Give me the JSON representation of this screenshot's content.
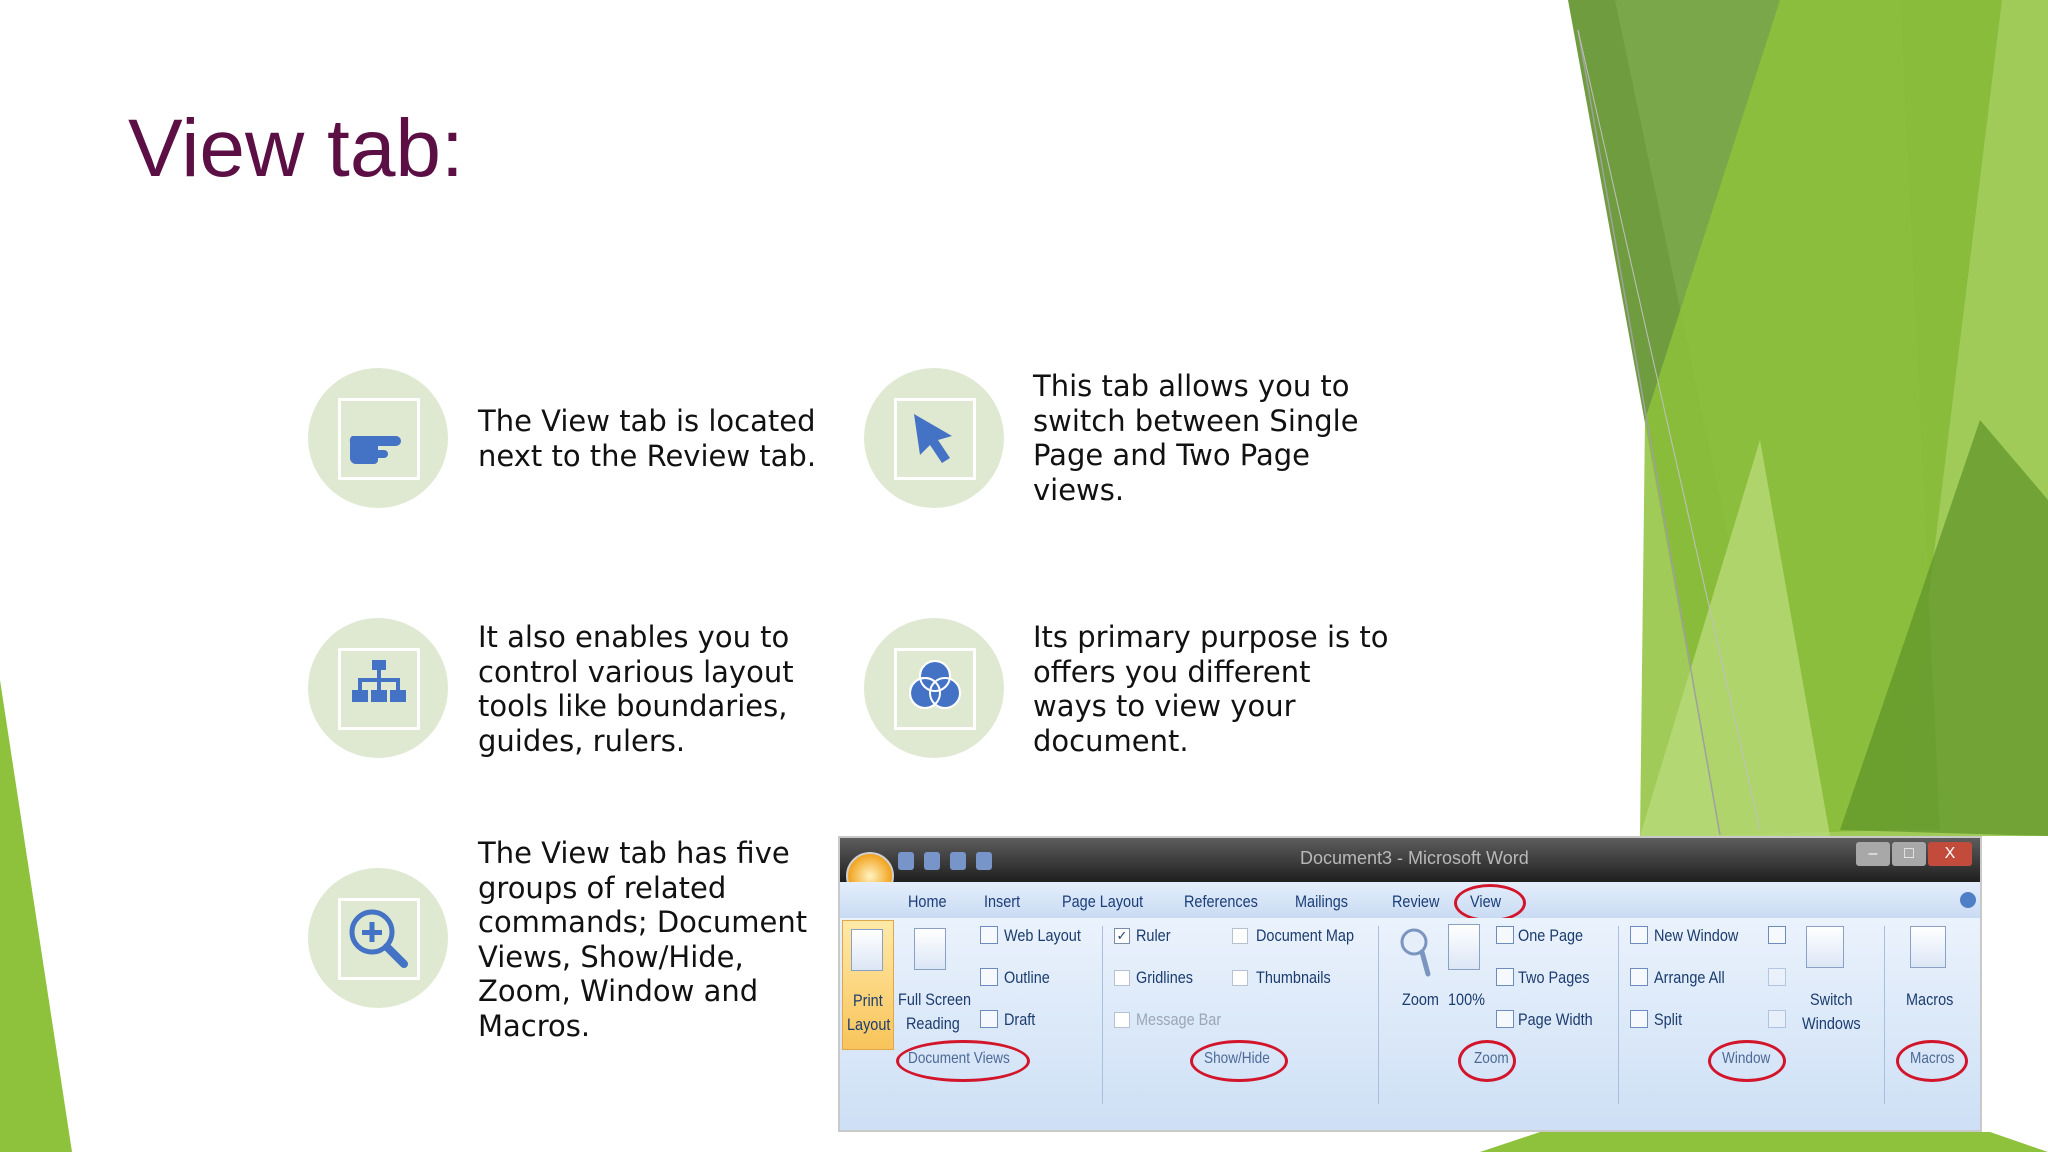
{
  "slide": {
    "title": "View tab:",
    "colors": {
      "title": "#5b0f45",
      "icon_circle": "#dfe9d2",
      "icon": "#4472c4",
      "green_dark": "#6c9a3e",
      "green_light": "#8fc23c"
    },
    "items": [
      {
        "icon": "pointing-hand-icon",
        "text_lines": [
          "The View tab is located",
          "next to the Review tab."
        ]
      },
      {
        "icon": "cursor-arrow-icon",
        "text_lines": [
          "This tab allows you to",
          "switch between Single",
          "Page and Two Page",
          "views."
        ]
      },
      {
        "icon": "org-chart-icon",
        "text_lines": [
          "It also enables you to",
          "control various layout",
          "tools like boundaries,",
          "guides, rulers."
        ]
      },
      {
        "icon": "venn-diagram-icon",
        "text_lines": [
          "Its primary purpose is to",
          "offers you different",
          "ways to view your",
          "document."
        ]
      },
      {
        "icon": "zoom-in-icon",
        "text_lines": [
          "The View tab has five",
          "groups of related",
          "commands; Document",
          "Views, Show/Hide,",
          "Zoom, Window and",
          "Macros."
        ]
      }
    ]
  },
  "screenshot": {
    "window_title": "Document3 - Microsoft Word",
    "window_buttons": [
      "–",
      "□",
      "X"
    ],
    "tabs": [
      "Home",
      "Insert",
      "Page Layout",
      "References",
      "Mailings",
      "Review",
      "View"
    ],
    "document_views": {
      "print_layout": [
        "Print",
        "Layout"
      ],
      "full_screen": [
        "Full Screen",
        "Reading"
      ],
      "web_layout": "Web Layout",
      "outline": "Outline",
      "draft": "Draft"
    },
    "show_hide": {
      "ruler": "Ruler",
      "gridlines": "Gridlines",
      "message_bar": "Message Bar",
      "document_map": "Document Map",
      "thumbnails": "Thumbnails"
    },
    "zoom": {
      "zoom": "Zoom",
      "hundred": "100%",
      "one_page": "One Page",
      "two_pages": "Two Pages",
      "page_width": "Page Width"
    },
    "window": {
      "new_window": "New Window",
      "arrange_all": "Arrange All",
      "split": "Split",
      "switch": [
        "Switch",
        "Windows"
      ]
    },
    "macros": {
      "macros": "Macros"
    },
    "groups": [
      "Document Views",
      "Show/Hide",
      "Zoom",
      "Window",
      "Macros"
    ]
  }
}
